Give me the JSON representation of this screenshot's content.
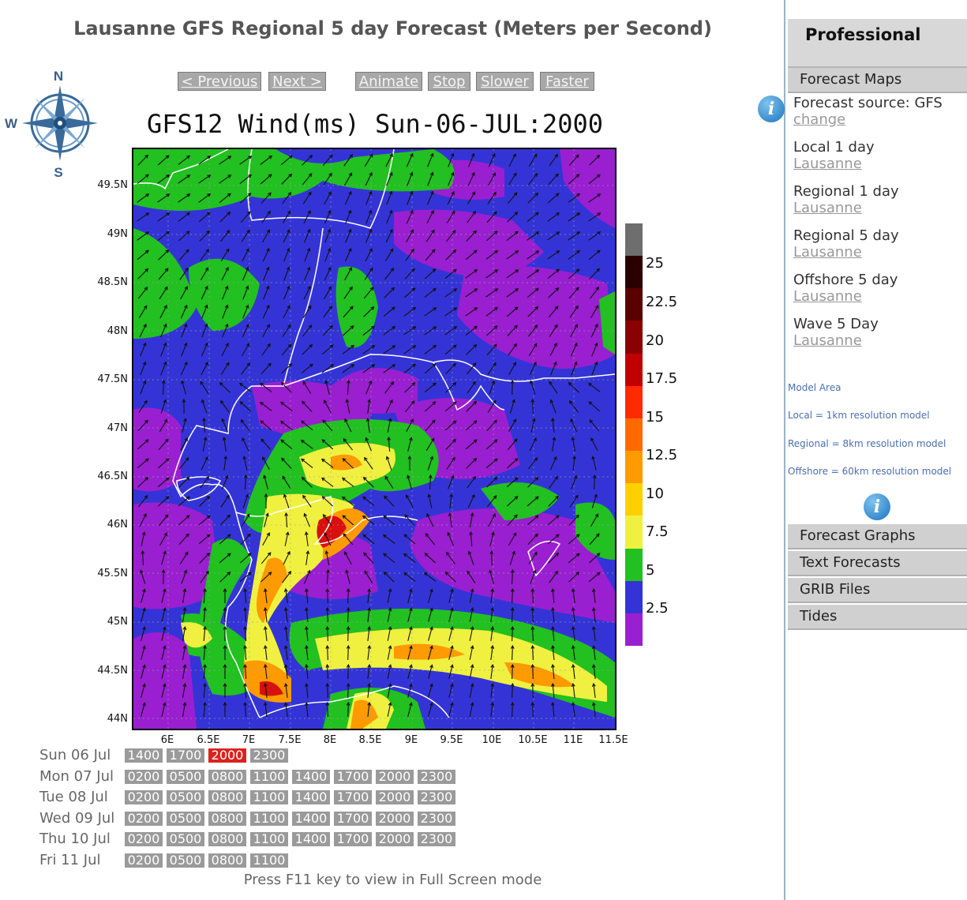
{
  "page": {
    "title": "Lausanne GFS Regional 5 day Forecast (Meters per Second)",
    "fullscreen_hint": "Press F11 key to view in Full Screen mode"
  },
  "compass": {
    "n": "N",
    "w": "W",
    "s": "S"
  },
  "nav": {
    "previous": "< Previous",
    "next": "Next >",
    "animate": "Animate",
    "stop": "Stop",
    "slower": "Slower",
    "faster": "Faster"
  },
  "map": {
    "title": "GFS12 Wind(ms) Sun-06-JUL:2000",
    "lat_labels": [
      "49.5N",
      "49N",
      "48.5N",
      "48N",
      "47.5N",
      "47N",
      "46.5N",
      "46N",
      "45.5N",
      "45N",
      "44.5N",
      "44N"
    ],
    "lon_labels": [
      "6E",
      "6.5E",
      "7E",
      "7.5E",
      "8E",
      "8.5E",
      "9E",
      "9.5E",
      "10E",
      "10.5E",
      "11E",
      "11.5E"
    ],
    "legend_labels": [
      "25",
      "22.5",
      "20",
      "17.5",
      "15",
      "12.5",
      "10",
      "7.5",
      "5",
      "2.5"
    ],
    "legend_colors": [
      "#6e6e6e",
      "#2a0000",
      "#5a0000",
      "#8a0000",
      "#c00000",
      "#ff2a00",
      "#ff6a00",
      "#ff9a00",
      "#ffd000",
      "#f0f040",
      "#22c020",
      "#3434d6",
      "#9a1fd0"
    ]
  },
  "schedule": [
    {
      "day": "Sun 06 Jul",
      "times": [
        "1400",
        "1700",
        "2000",
        "2300"
      ],
      "offset": 0,
      "active": "2000"
    },
    {
      "day": "Mon 07 Jul",
      "times": [
        "0200",
        "0500",
        "0800",
        "1100",
        "1400",
        "1700",
        "2000",
        "2300"
      ],
      "offset": 0,
      "active": ""
    },
    {
      "day": "Tue 08 Jul",
      "times": [
        "0200",
        "0500",
        "0800",
        "1100",
        "1400",
        "1700",
        "2000",
        "2300"
      ],
      "offset": 0,
      "active": ""
    },
    {
      "day": "Wed 09 Jul",
      "times": [
        "0200",
        "0500",
        "0800",
        "1100",
        "1400",
        "1700",
        "2000",
        "2300"
      ],
      "offset": 0,
      "active": ""
    },
    {
      "day": "Thu 10 Jul",
      "times": [
        "0200",
        "0500",
        "0800",
        "1100",
        "1400",
        "1700",
        "2000",
        "2300"
      ],
      "offset": 0,
      "active": ""
    },
    {
      "day": "Fri 11 Jul",
      "times": [
        "0200",
        "0500",
        "0800",
        "1100"
      ],
      "offset": 0,
      "active": ""
    }
  ],
  "sidebar": {
    "heading": "Professional",
    "forecast_maps": "Forecast Maps",
    "source_label": "Forecast source: GFS",
    "source_change": "change",
    "links": [
      {
        "title": "Local 1 day",
        "loc": "Lausanne"
      },
      {
        "title": "Regional 1 day",
        "loc": "Lausanne"
      },
      {
        "title": "Regional 5 day",
        "loc": "Lausanne"
      },
      {
        "title": "Offshore 5 day",
        "loc": "Lausanne"
      },
      {
        "title": "Wave 5 Day",
        "loc": "Lausanne"
      }
    ],
    "notes": [
      "Model Area",
      "Local = 1km resolution model",
      "Regional = 8km resolution model",
      "Offshore = 60km resolution model"
    ],
    "info_glyph": "i",
    "bottom_items": [
      "Forecast Graphs",
      "Text Forecasts",
      "GRIB Files",
      "Tides"
    ]
  }
}
